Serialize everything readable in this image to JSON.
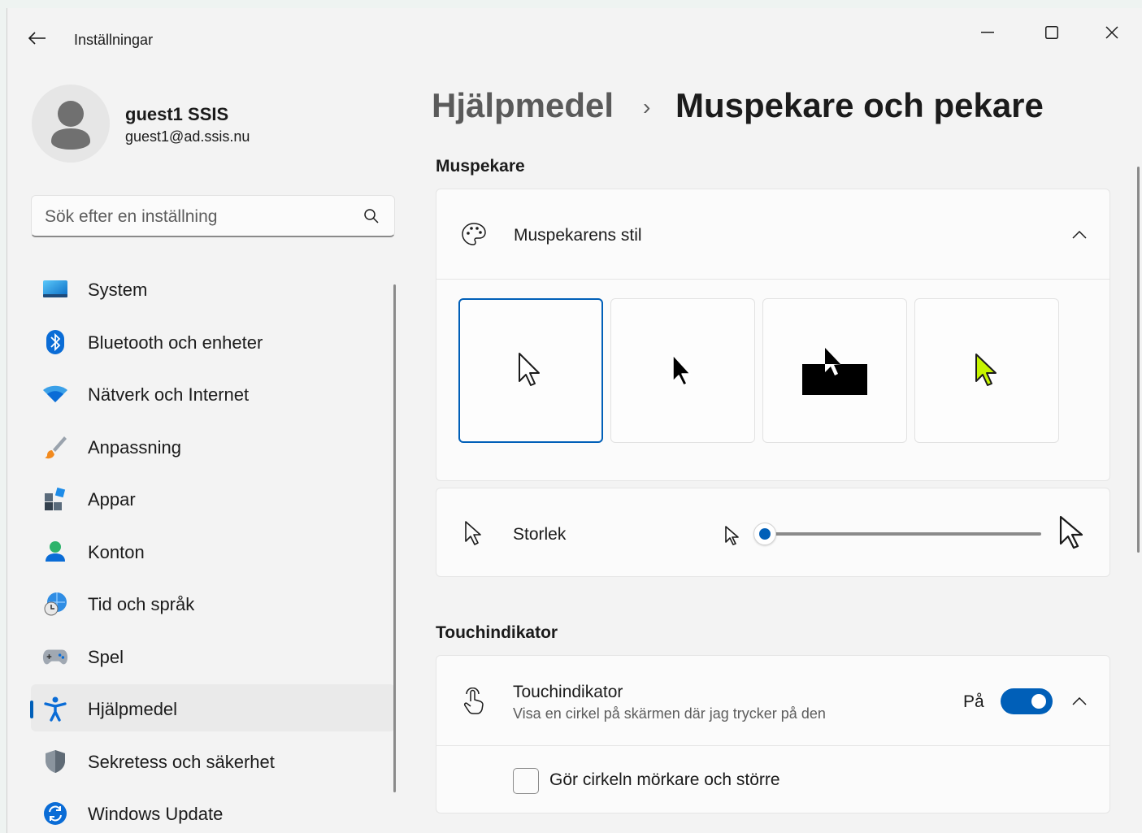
{
  "window": {
    "title": "Inställningar"
  },
  "account": {
    "name": "guest1 SSIS",
    "email": "guest1@ad.ssis.nu"
  },
  "search": {
    "placeholder": "Sök efter en inställning"
  },
  "nav": {
    "items": [
      {
        "label": "System",
        "icon": "system-icon"
      },
      {
        "label": "Bluetooth och enheter",
        "icon": "bluetooth-icon"
      },
      {
        "label": "Nätverk och Internet",
        "icon": "wifi-icon"
      },
      {
        "label": "Anpassning",
        "icon": "paintbrush-icon"
      },
      {
        "label": "Appar",
        "icon": "apps-icon"
      },
      {
        "label": "Konton",
        "icon": "accounts-icon"
      },
      {
        "label": "Tid och språk",
        "icon": "globe-clock-icon"
      },
      {
        "label": "Spel",
        "icon": "gamepad-icon"
      },
      {
        "label": "Hjälpmedel",
        "icon": "accessibility-icon",
        "active": true
      },
      {
        "label": "Sekretess och säkerhet",
        "icon": "shield-icon"
      },
      {
        "label": "Windows Update",
        "icon": "update-icon"
      }
    ]
  },
  "breadcrumb": {
    "parent": "Hjälpmedel",
    "separator": "›",
    "current": "Muspekare och pekare"
  },
  "sections": {
    "pointer": {
      "title": "Muspekare",
      "style_card": {
        "label": "Muspekarens stil",
        "icon": "palette-icon",
        "expanded": true,
        "options": [
          "white",
          "black",
          "inverted",
          "custom"
        ],
        "selected": "white",
        "custom_color": "#c6f400"
      },
      "size_card": {
        "label": "Storlek",
        "icon": "pointer-icon",
        "value": 1
      }
    },
    "touch": {
      "title": "Touchindikator",
      "card": {
        "label": "Touchindikator",
        "description": "Visa en cirkel på skärmen där jag trycker på den",
        "icon": "touch-icon",
        "toggle_label": "På",
        "toggle_on": true
      },
      "option": {
        "label": "Gör cirkeln mörkare och större",
        "checked": false
      }
    }
  },
  "colors": {
    "accent": "#005fb8",
    "background": "#f3f3f3",
    "card": "#fbfbfb"
  }
}
